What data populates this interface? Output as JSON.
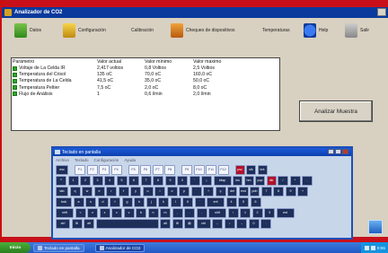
{
  "window": {
    "title": "Analizador de CO2"
  },
  "toolbar": {
    "items": [
      {
        "label": "Datos",
        "icon": "data-icon"
      },
      {
        "label": "Configuración",
        "icon": "wrench-icon"
      },
      {
        "label": "Calibración",
        "icon": "calibration-icon"
      },
      {
        "label": "Chequeo de dispositivos",
        "icon": "device-check-icon"
      },
      {
        "label": "Temperaturas",
        "icon": "thermometer-icon"
      },
      {
        "label": "Help",
        "icon": "info-icon"
      },
      {
        "label": "Salir",
        "icon": "exit-icon"
      }
    ]
  },
  "table": {
    "headers": [
      "Parámetro",
      "Valor actual",
      "Valor mínimo",
      "Valor máximo"
    ],
    "rows": [
      [
        "Voltaje de La Celda IR",
        "2,417 voltios",
        "0,8 Voltios",
        "2,5 Voltios"
      ],
      [
        "Temperatura del Crisol",
        "135 oC",
        "70,0 oC",
        "160,0 oC"
      ],
      [
        "Temperatura de La Celda",
        "41,5 oC",
        "35,0 oC",
        "50,0 oC"
      ],
      [
        "Temperatura Peltier",
        "7,5 oC",
        "2,0 oC",
        "8,0 oC"
      ],
      [
        "Flujo de Análisis",
        "1",
        "0,6 l/min",
        "2,0 l/min"
      ]
    ]
  },
  "analyze_button": {
    "label": "Analizar Muestra"
  },
  "keyboard": {
    "title": "Teclado en pantalla",
    "menu": [
      "Archivo",
      "Teclado",
      "Configuración",
      "Ayuda"
    ],
    "rows": [
      [
        "esc",
        "F1",
        "F2",
        "F3",
        "F4",
        "F5",
        "F6",
        "F7",
        "F8",
        "F9",
        "F10",
        "F11",
        "F12",
        "psc",
        "slk",
        "brk"
      ],
      [
        "º",
        "1",
        "2",
        "3",
        "4",
        "5",
        "6",
        "7",
        "8",
        "9",
        "0",
        "'",
        "¡",
        "bksp",
        "ins",
        "hm",
        "pup",
        "nlk",
        "/",
        "*",
        "-"
      ],
      [
        "tab",
        "q",
        "w",
        "e",
        "r",
        "t",
        "y",
        "u",
        "i",
        "o",
        "p",
        "`",
        "+",
        "ç",
        "del",
        "end",
        "pdn",
        "7",
        "8",
        "9",
        "+"
      ],
      [
        "lock",
        "a",
        "s",
        "d",
        "f",
        "g",
        "h",
        "j",
        "k",
        "l",
        "ñ",
        "´",
        "ent",
        "4",
        "5",
        "6"
      ],
      [
        "shft",
        "<",
        "z",
        "x",
        "c",
        "v",
        "b",
        "n",
        "m",
        ",",
        ".",
        "-",
        "shft",
        "↑",
        "1",
        "2",
        "3",
        "ent"
      ],
      [
        "ctrl",
        "⊞",
        "alt",
        "",
        "alt",
        "⊞",
        "▤",
        "ctrl",
        "←",
        "↓",
        "→",
        "0",
        "."
      ]
    ]
  },
  "taskbar": {
    "start": "Inicio",
    "tasks": [
      "Teclado en pantalla",
      "Analizador de CO2"
    ],
    "clock": "8:55"
  }
}
